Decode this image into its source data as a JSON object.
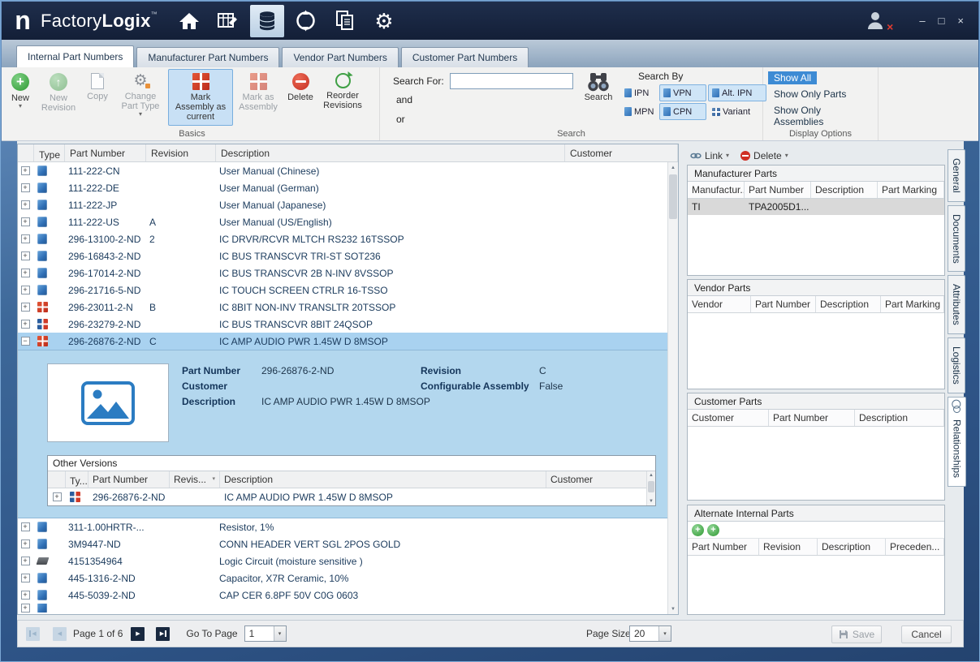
{
  "titlebar": {
    "logo": "n",
    "brand": {
      "part1": "Factory",
      "part2": "Logix",
      "tm": "™"
    }
  },
  "icons": {
    "minimize": "–",
    "maximize": "□",
    "close": "×",
    "caret_down": "▾",
    "sort_asc": "▲",
    "scroll_up": "▲",
    "scroll_down": "▼",
    "prev": "◀",
    "next": "▶",
    "plus": "+",
    "minus": "−"
  },
  "tabs": [
    {
      "label": "Internal Part Numbers",
      "active": true
    },
    {
      "label": "Manufacturer Part Numbers",
      "active": false
    },
    {
      "label": "Vendor Part Numbers",
      "active": false
    },
    {
      "label": "Customer Part Numbers",
      "active": false
    }
  ],
  "ribbon": {
    "new": "New",
    "new_revision": "New Revision",
    "copy": "Copy",
    "change_part_type": "Change Part Type",
    "mark_assembly_current": "Mark Assembly as current",
    "mark_as_assembly": "Mark as Assembly",
    "delete": "Delete",
    "reorder_revisions": "Reorder Revisions",
    "basics_group": "Basics",
    "search_for": "Search For:",
    "search_value": "",
    "and": "and",
    "or": "or",
    "search_btn": "Search",
    "search_group": "Search",
    "search_by": "Search By",
    "filters": [
      {
        "label": "IPN",
        "active": false,
        "icon": "doc"
      },
      {
        "label": "VPN",
        "active": true,
        "icon": "doc"
      },
      {
        "label": "Alt. IPN",
        "active": true,
        "icon": "doc"
      },
      {
        "label": "MPN",
        "active": false,
        "icon": "doc"
      },
      {
        "label": "CPN",
        "active": true,
        "icon": "doc"
      },
      {
        "label": "Variant",
        "active": false,
        "icon": "grid"
      }
    ],
    "show_all": "Show All",
    "show_only_parts": "Show Only Parts",
    "show_only_assemblies": "Show Only Assemblies",
    "display_group": "Display Options"
  },
  "grid": {
    "columns": {
      "type": "Type",
      "part_number": "Part Number",
      "revision": "Revision",
      "description": "Description",
      "customer": "Customer"
    },
    "rows": [
      {
        "icon": "doc",
        "part_number": "111-222-CN",
        "revision": "",
        "description": "User Manual (Chinese)",
        "customer": ""
      },
      {
        "icon": "doc",
        "part_number": "111-222-DE",
        "revision": "",
        "description": "User Manual (German)",
        "customer": ""
      },
      {
        "icon": "doc",
        "part_number": "111-222-JP",
        "revision": "",
        "description": "User Manual (Japanese)",
        "customer": ""
      },
      {
        "icon": "doc",
        "part_number": "111-222-US",
        "revision": "A",
        "description": "User Manual (US/English)",
        "customer": ""
      },
      {
        "icon": "doc",
        "part_number": "296-13100-2-ND",
        "revision": "2",
        "description": "IC DRVR/RCVR MLTCH RS232 16TSSOP",
        "customer": ""
      },
      {
        "icon": "doc",
        "part_number": "296-16843-2-ND",
        "revision": "",
        "description": "IC BUS TRANSCVR TRI-ST SOT236",
        "customer": ""
      },
      {
        "icon": "doc",
        "part_number": "296-17014-2-ND",
        "revision": "",
        "description": "IC BUS TRANSCVR 2B N-INV 8VSSOP",
        "customer": ""
      },
      {
        "icon": "doc",
        "part_number": "296-21716-5-ND",
        "revision": "",
        "description": "IC TOUCH SCREEN CTRLR 16-TSSO",
        "customer": ""
      },
      {
        "icon": "asm",
        "part_number": "296-23011-2-N",
        "revision": "B",
        "description": "IC 8BIT NON-INV TRANSLTR 20TSSOP",
        "customer": ""
      },
      {
        "icon": "asm2",
        "part_number": "296-23279-2-ND",
        "revision": "",
        "description": "IC BUS TRANSCVR 8BIT 24QSOP",
        "customer": ""
      },
      {
        "icon": "asm",
        "part_number": "296-26876-2-ND",
        "revision": "C",
        "description": "IC AMP AUDIO PWR 1.45W D 8MSOP",
        "customer": "",
        "selected": true,
        "expanded": true
      },
      {
        "icon": "doc",
        "part_number": "311-1.00HRTR-...",
        "revision": "",
        "description": "Resistor, 1%",
        "customer": ""
      },
      {
        "icon": "doc",
        "part_number": "3M9447-ND",
        "revision": "",
        "description": "CONN HEADER VERT SGL 2POS GOLD",
        "customer": ""
      },
      {
        "icon": "chip",
        "part_number": "4151354964",
        "revision": "",
        "description": "Logic Circuit (moisture sensitive )",
        "customer": ""
      },
      {
        "icon": "doc",
        "part_number": "445-1316-2-ND",
        "revision": "",
        "description": "Capacitor,  X7R Ceramic, 10%",
        "customer": ""
      },
      {
        "icon": "doc",
        "part_number": "445-5039-2-ND",
        "revision": "",
        "description": "CAP CER 6.8PF 50V C0G 0603",
        "customer": ""
      },
      {
        "icon": "doc",
        "part_number": "",
        "revision": "",
        "description": "",
        "customer": "",
        "clipped": true
      }
    ]
  },
  "detail": {
    "part_number_label": "Part Number",
    "part_number": "296-26876-2-ND",
    "customer_label": "Customer",
    "customer": "",
    "description_label": "Description",
    "description": "IC AMP AUDIO PWR 1.45W D 8MSOP",
    "revision_label": "Revision",
    "revision": "C",
    "configurable_label": "Configurable Assembly",
    "configurable": "False",
    "other_versions": {
      "title": "Other Versions",
      "columns": {
        "type": "Ty...",
        "part_number": "Part Number",
        "revision": "Revis...",
        "description": "Description",
        "customer": "Customer"
      },
      "rows": [
        {
          "icon": "asm2",
          "part_number": "296-26876-2-ND",
          "revision": "",
          "description": "IC AMP AUDIO PWR 1.45W D 8MSOP",
          "customer": ""
        }
      ]
    }
  },
  "right_panel": {
    "link_btn": "Link",
    "delete_btn": "Delete",
    "sections": {
      "manufacturer": {
        "title": "Manufacturer Parts",
        "columns": [
          "Manufactur...",
          "Part Number",
          "Description",
          "Part Marking"
        ],
        "rows": [
          [
            "TI",
            "TPA2005D1...",
            "",
            ""
          ]
        ]
      },
      "vendor": {
        "title": "Vendor Parts",
        "columns": [
          "Vendor",
          "Part Number",
          "Description",
          "Part Marking"
        ],
        "rows": []
      },
      "customer": {
        "title": "Customer Parts",
        "columns": [
          "Customer",
          "Part Number",
          "Description"
        ],
        "rows": []
      },
      "alternate": {
        "title": "Alternate Internal Parts",
        "columns": [
          "Part Number",
          "Revision",
          "Description",
          "Preceden..."
        ],
        "rows": []
      }
    }
  },
  "side_tabs": [
    {
      "label": "General",
      "active": false
    },
    {
      "label": "Documents",
      "active": false
    },
    {
      "label": "Attributes",
      "active": false
    },
    {
      "label": "Logistics",
      "active": false
    },
    {
      "label": "Relationships",
      "active": true
    }
  ],
  "pagination": {
    "page_text": "Page 1 of 6",
    "go_to_page": "Go To Page",
    "go_to_value": "1",
    "page_size_label": "Page Size",
    "page_size_value": "20",
    "save": "Save",
    "cancel": "Cancel"
  }
}
